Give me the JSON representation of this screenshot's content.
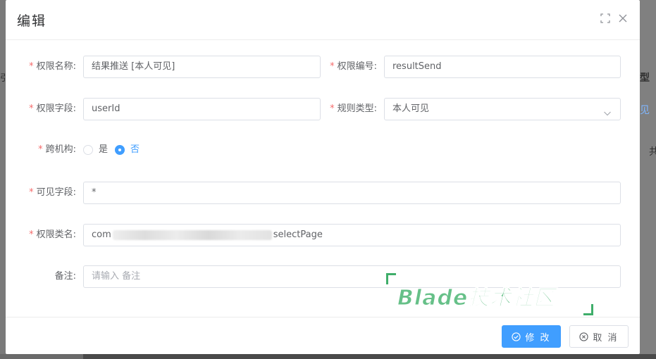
{
  "background": {
    "right_texts": [
      "型",
      "见",
      "共"
    ],
    "left_text": "引"
  },
  "dialog": {
    "title": "编辑",
    "icons": {
      "fullscreen": "fullscreen-icon",
      "close": "close-icon"
    }
  },
  "form": {
    "required_mark": "*",
    "permission_name": {
      "label": "权限名称:",
      "value": "结果推送 [本人可见]"
    },
    "permission_code": {
      "label": "权限编号:",
      "value": "resultSend"
    },
    "permission_field": {
      "label": "权限字段:",
      "value": "userId"
    },
    "rule_type": {
      "label": "规则类型:",
      "value": "本人可见"
    },
    "cross_org": {
      "label": "跨机构:",
      "options": [
        {
          "label": "是",
          "checked": false
        },
        {
          "label": "否",
          "checked": true
        }
      ]
    },
    "visible_field": {
      "label": "可见字段:",
      "value": "*"
    },
    "class_name": {
      "label": "权限类名:",
      "value_prefix": "com",
      "value_suffix": "selectPage"
    },
    "remark": {
      "label": "备注:",
      "placeholder": "请输入 备注"
    }
  },
  "watermark": {
    "text": "Blade技术社区"
  },
  "footer": {
    "submit_label": "修 改",
    "cancel_label": "取 消"
  },
  "colors": {
    "primary": "#409eff",
    "required": "#f56c6c",
    "watermark": "#66c088"
  }
}
